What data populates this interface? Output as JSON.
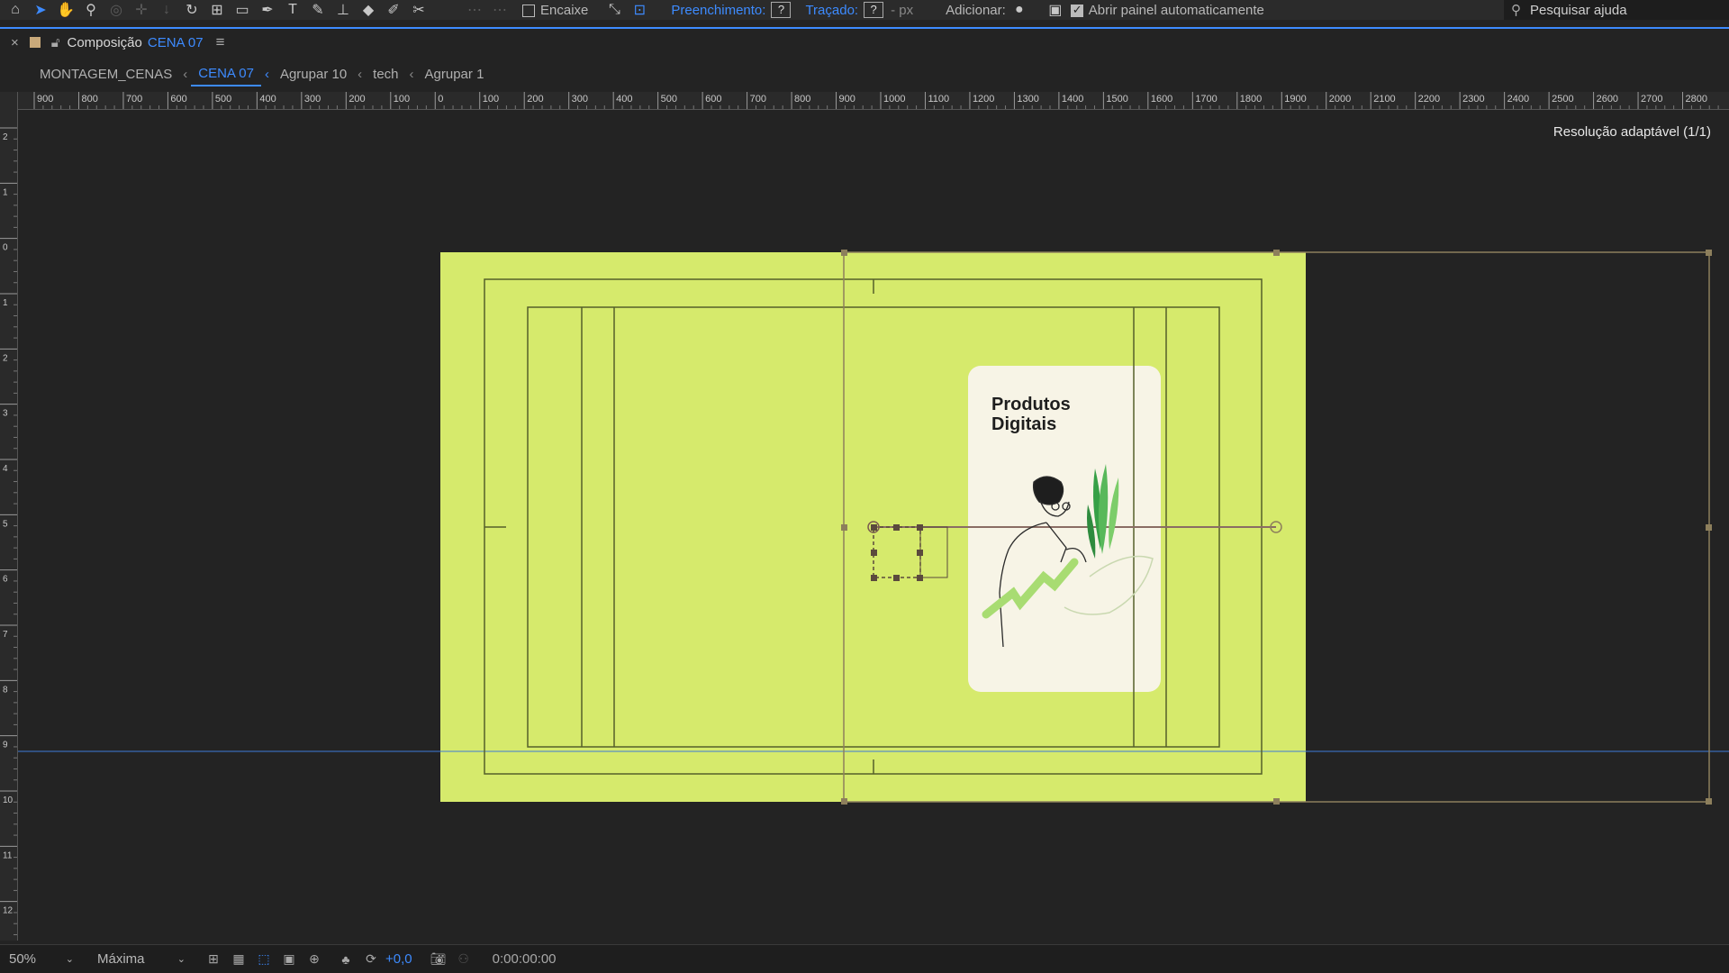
{
  "toolbar": {
    "tools": [
      "home-icon",
      "selection-arrow-icon",
      "hand-icon",
      "zoom-icon",
      "rotate-camera-icon",
      "move-camera-icon",
      "pan-behind-icon",
      "rotate-icon",
      "anchor-icon",
      "rectangle-icon",
      "pen-icon",
      "text-icon",
      "brush-icon",
      "clone-stamp-icon",
      "eraser-icon",
      "roto-brush-icon",
      "puppet-pin-icon"
    ],
    "snap_label": "Encaixe",
    "fill_label": "Preenchimento:",
    "fill_value": "?",
    "stroke_label": "Traçado:",
    "stroke_value": "?",
    "stroke_px": "- px",
    "add_label": "Adicionar:",
    "auto_panel_label": "Abrir painel automaticamente",
    "search_placeholder": "Pesquisar ajuda",
    "accent_color": "#3d8bff"
  },
  "panel": {
    "close_glyph": "×",
    "title_prefix": "Composição",
    "title_comp": "CENA 07",
    "menu_glyph": "≡"
  },
  "breadcrumbs": [
    "MONTAGEM_CENAS",
    "CENA 07",
    "Agrupar 10",
    "tech",
    "Agrupar 1"
  ],
  "ruler": {
    "h_labels": [
      "900",
      "800",
      "700",
      "600",
      "500",
      "400",
      "300",
      "200",
      "100",
      "0",
      "100",
      "200",
      "300",
      "400",
      "500",
      "600",
      "700",
      "800",
      "900",
      "1000",
      "1100",
      "1200",
      "1300",
      "1400",
      "1500",
      "1600",
      "1700",
      "1800",
      "1900",
      "2000",
      "2100",
      "2200",
      "2300",
      "2400",
      "2500",
      "2600",
      "2700",
      "2800"
    ],
    "v_labels": [
      "2",
      "1",
      "0",
      "1",
      "2",
      "3",
      "4",
      "5",
      "6",
      "7",
      "8",
      "9",
      "10",
      "11",
      "12"
    ]
  },
  "viewer": {
    "resolution_label": "Resolução adaptável (1/1)",
    "artboard_color": "#d6ea6c",
    "card_color": "#f7f4e6",
    "card_title_line1": "Produtos",
    "card_title_line2": "Digitais"
  },
  "bottom_bar": {
    "zoom": "50%",
    "quality": "Máxima",
    "exposure": "+0,0",
    "timecode": "0:00:00:00"
  }
}
